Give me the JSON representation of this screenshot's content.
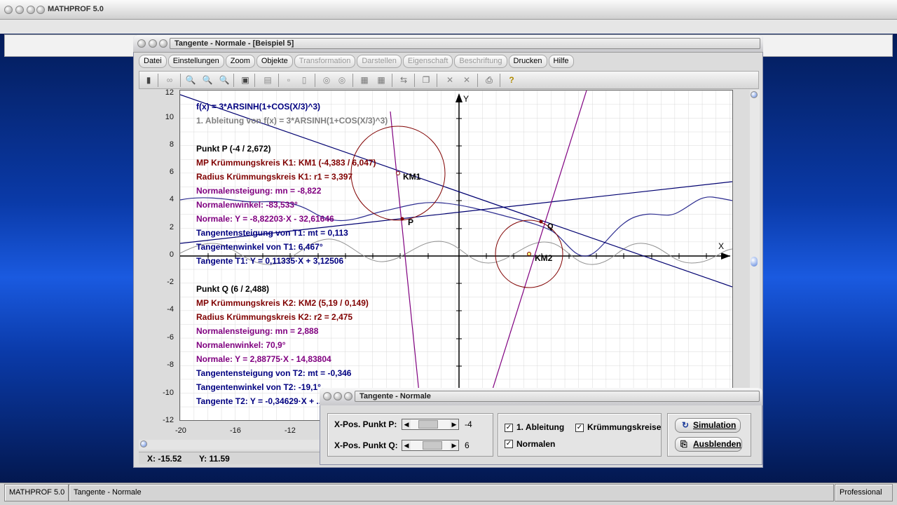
{
  "app": {
    "title": "MATHPROF 5.0"
  },
  "child_window": {
    "title": "Tangente - Normale - [Beispiel 5]"
  },
  "menu": [
    {
      "label": "Datei",
      "enabled": true
    },
    {
      "label": "Einstellungen",
      "enabled": true
    },
    {
      "label": "Zoom",
      "enabled": true
    },
    {
      "label": "Objekte",
      "enabled": true
    },
    {
      "label": "Transformation",
      "enabled": false
    },
    {
      "label": "Darstellen",
      "enabled": false
    },
    {
      "label": "Eigenschaft",
      "enabled": false
    },
    {
      "label": "Beschriftung",
      "enabled": false
    },
    {
      "label": "Drucken",
      "enabled": true
    },
    {
      "label": "Hilfe",
      "enabled": true
    }
  ],
  "toolbar": {
    "icons": [
      "calculator-icon",
      "glasses-icon",
      "zoom-out-icon",
      "zoom-reset-icon",
      "zoom-in-icon",
      "settings-icon",
      "window-icon",
      "frame-small-icon",
      "frame-large-icon",
      "circle-a-icon",
      "circle-b-icon",
      "table-icon",
      "grid-icon",
      "transfer-icon",
      "copy-icon",
      "delete-icon",
      "delete-all-icon",
      "print-icon",
      "help-icon"
    ]
  },
  "graph": {
    "y_ticks": [
      "12",
      "10",
      "8",
      "6",
      "4",
      "2",
      "0",
      "-2",
      "-4",
      "-6",
      "-8",
      "-10",
      "-12"
    ],
    "x_ticks": [
      "-20",
      "-16",
      "-12"
    ],
    "axis_x": "X",
    "axis_y": "Y",
    "point_labels": {
      "p": "P",
      "q": "Q",
      "km1": "KM1",
      "km2": "KM2"
    },
    "info": [
      {
        "text": "f(x) = 3*ARSINH(1+COS(X/3)^3)",
        "color": "#000080"
      },
      {
        "text": "1. Ableitung von f(x) = 3*ARSINH(1+COS(X/3)^3)",
        "color": "#808080"
      },
      {
        "text": "",
        "color": "#000000"
      },
      {
        "text": "Punkt P (-4 / 2,672)",
        "color": "#000000"
      },
      {
        "text": "MP Krümmungskreis K1: KM1 (-4,383 / 6,047)",
        "color": "#800000"
      },
      {
        "text": "Radius Krümmungskreis K1: r1 = 3,397",
        "color": "#800000"
      },
      {
        "text": "Normalensteigung: mn = -8,822",
        "color": "#800080"
      },
      {
        "text": "Normalenwinkel: -83,533°",
        "color": "#800080"
      },
      {
        "text": "Normale: Y = -8,82203·X - 32,61646",
        "color": "#800080"
      },
      {
        "text": "Tangentensteigung von T1: mt = 0,113",
        "color": "#000080"
      },
      {
        "text": "Tangentenwinkel von T1: 6,467°",
        "color": "#000080"
      },
      {
        "text": "Tangente T1: Y = 0,11335·X + 3,12506",
        "color": "#000080"
      },
      {
        "text": "",
        "color": "#000000"
      },
      {
        "text": "Punkt Q (6 / 2,488)",
        "color": "#000000"
      },
      {
        "text": "MP Krümmungskreis K2: KM2 (5,19 / 0,149)",
        "color": "#800000"
      },
      {
        "text": "Radius Krümmungskreis K2: r2 = 2,475",
        "color": "#800000"
      },
      {
        "text": "Normalensteigung: mn = 2,888",
        "color": "#800080"
      },
      {
        "text": "Normalenwinkel: 70,9°",
        "color": "#800080"
      },
      {
        "text": "Normale: Y = 2,88775·X - 14,83804",
        "color": "#800080"
      },
      {
        "text": "Tangentensteigung von T2: mt = -0,346",
        "color": "#000080"
      },
      {
        "text": "Tangentenwinkel von T2: -19,1°",
        "color": "#000080"
      },
      {
        "text": "Tangente T2: Y = -0,34629·X + ...",
        "color": "#000080"
      }
    ]
  },
  "coords": {
    "x": "X: -15.52",
    "y": "Y: 11.59"
  },
  "dialog": {
    "title": "Tangente - Normale",
    "slider_p": {
      "label": "X-Pos. Punkt P:",
      "value": "-4",
      "fraction": 0.4
    },
    "slider_q": {
      "label": "X-Pos. Punkt Q:",
      "value": "6",
      "fraction": 0.62
    },
    "chk_ableitung": {
      "label": "1. Ableitung",
      "checked": true
    },
    "chk_kruemmung": {
      "label": "Krümmungskreise",
      "checked": true
    },
    "chk_normalen": {
      "label": "Normalen",
      "checked": true
    },
    "btn_simulation": "Simulation",
    "btn_ausblenden": "Ausblenden"
  },
  "statusbar": {
    "app": "MATHPROF 5.0",
    "doc": "Tangente - Normale",
    "edition": "Professional"
  }
}
